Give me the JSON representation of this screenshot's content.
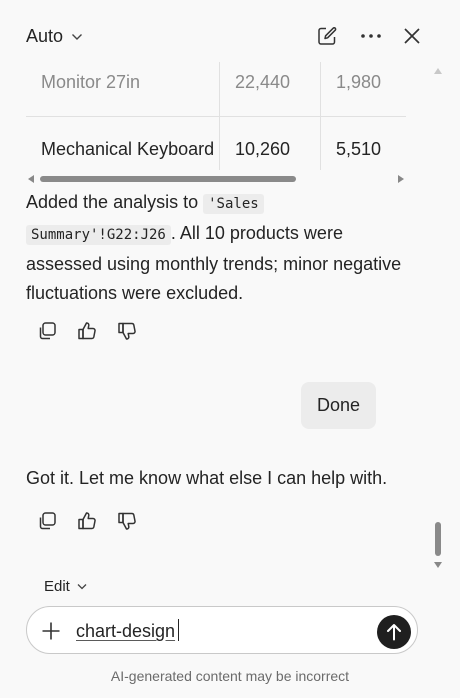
{
  "header": {
    "mode_label": "Auto",
    "icons": [
      "compose-icon",
      "more-icon",
      "close-icon"
    ]
  },
  "table": {
    "rows": [
      [
        "Monitor 27in",
        "22,440",
        "1,980"
      ],
      [
        "Mechanical Keyboard",
        "10,260",
        "5,510"
      ]
    ]
  },
  "assistant_reply": {
    "text_before": "Added the analysis to ",
    "code_line1": "'Sales",
    "code_line2": "Summary'!G22:J26",
    "text_after": ". All 10 products were assessed using monthly trends; minor negative fluctuations were excluded."
  },
  "user_message": "Done",
  "assistant_reply_2": "Got it. Let me know what else I can help with.",
  "composer": {
    "mode_label": "Edit",
    "input_value": "chart-design"
  },
  "disclaimer": "AI-generated content may be incorrect"
}
